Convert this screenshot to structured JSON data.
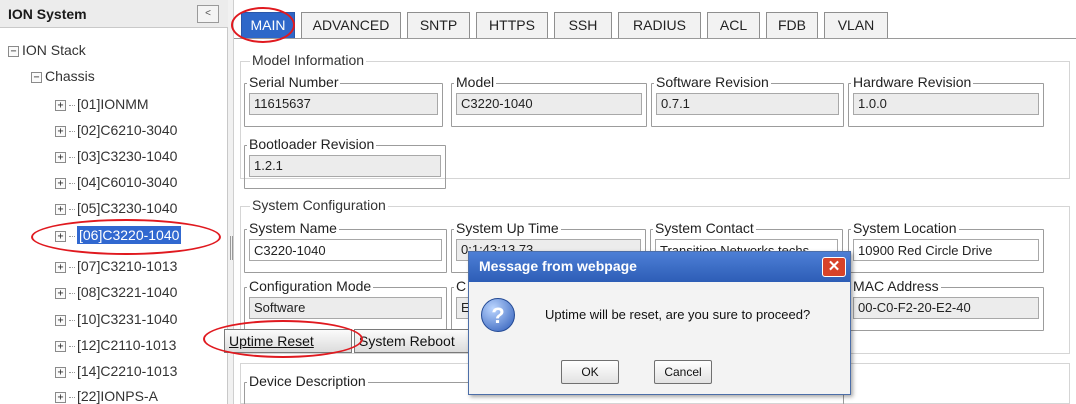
{
  "tree": {
    "title": "ION System",
    "collapse_glyph": "<",
    "root": {
      "label": "ION Stack",
      "expander": "−"
    },
    "chassis": {
      "label": "Chassis",
      "expander": "−"
    },
    "items": [
      {
        "label": "[01]IONMM",
        "expander": "+"
      },
      {
        "label": "[02]C6210-3040",
        "expander": "+"
      },
      {
        "label": "[03]C3230-1040",
        "expander": "+"
      },
      {
        "label": "[04]C6010-3040",
        "expander": "+"
      },
      {
        "label": "[05]C3230-1040",
        "expander": "+"
      },
      {
        "label": "[06]C3220-1040",
        "expander": "+"
      },
      {
        "label": "[07]C3210-1013",
        "expander": "+"
      },
      {
        "label": "[08]C3221-1040",
        "expander": "+"
      },
      {
        "label": "[10]C3231-1040",
        "expander": "+"
      },
      {
        "label": "[12]C2110-1013",
        "expander": "+"
      },
      {
        "label": "[14]C2210-1013",
        "expander": "+"
      },
      {
        "label": "[22]IONPS-A",
        "expander": "+"
      }
    ]
  },
  "tabs": [
    "MAIN",
    "ADVANCED",
    "SNTP",
    "HTTPS",
    "SSH",
    "RADIUS",
    "ACL",
    "FDB",
    "VLAN"
  ],
  "active_tab": "MAIN",
  "model_info": {
    "title": "Model Information",
    "serial_number": {
      "label": "Serial Number",
      "value": "11615637"
    },
    "model": {
      "label": "Model",
      "value": "C3220-1040"
    },
    "software_revision": {
      "label": "Software Revision",
      "value": "0.7.1"
    },
    "hardware_revision": {
      "label": "Hardware Revision",
      "value": "1.0.0"
    },
    "bootloader_revision": {
      "label": "Bootloader Revision",
      "value": "1.2.1"
    }
  },
  "system_config": {
    "title": "System Configuration",
    "system_name": {
      "label": "System Name",
      "value": "C3220-1040"
    },
    "system_up_time": {
      "label": "System Up Time",
      "value": "0:1:43:13.73"
    },
    "system_contact": {
      "label": "System Contact",
      "value": "Transition Networks techs"
    },
    "system_location": {
      "label": "System Location",
      "value": "10900 Red Circle Drive"
    },
    "configuration_mode": {
      "label": "Configuration Mode",
      "value": "Software"
    },
    "config_partial": {
      "label": "C",
      "value": "E"
    },
    "mac_address": {
      "label": "MAC Address",
      "value": "00-C0-F2-20-E2-40"
    },
    "uptime_reset_label": "Uptime Reset",
    "system_reboot_label": "System Reboot"
  },
  "device_description": {
    "label": "Device Description",
    "value": ""
  },
  "dialog": {
    "title": "Message from webpage",
    "close_glyph": "✕",
    "icon_glyph": "?",
    "message": "Uptime will be reset, are you sure to proceed?",
    "ok_label": "OK",
    "cancel_label": "Cancel"
  },
  "colors": {
    "active_tab": "#2e67c9",
    "dialog_titlebar": "#3a6cc6",
    "annotation": "#e0191f"
  }
}
